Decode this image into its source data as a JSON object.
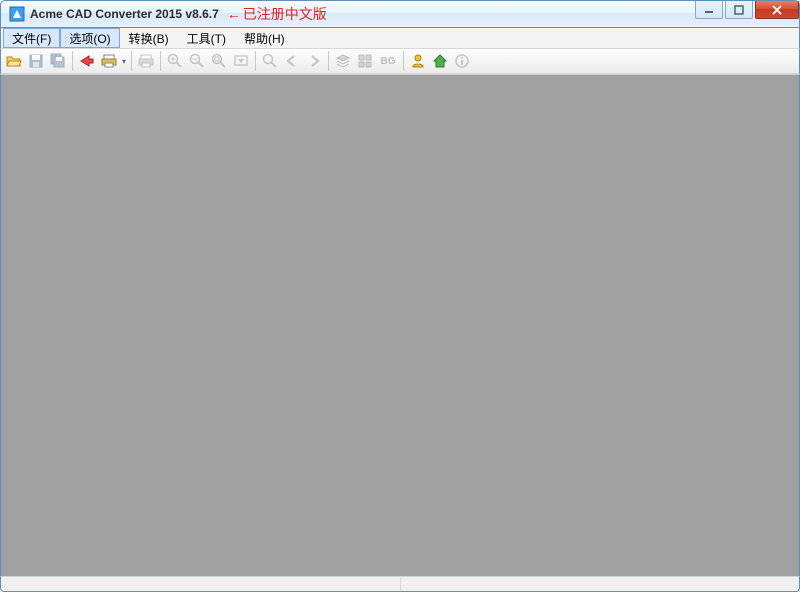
{
  "window": {
    "title": "Acme CAD Converter 2015 v8.6.7",
    "annotation": "已注册中文版",
    "annotation_arrow": "←"
  },
  "menu": {
    "file": "文件(F)",
    "options": "选项(O)",
    "convert": "转换(B)",
    "tools": "工具(T)",
    "help": "帮助(H)"
  },
  "toolbar": {
    "bg_label": "BG"
  },
  "icons": {
    "open": "open-folder-icon",
    "save": "save-icon",
    "save_all": "save-all-icon",
    "convert": "convert-icon",
    "print": "print-icon",
    "print2": "print-icon",
    "zoom_in": "zoom-in-icon",
    "zoom_out": "zoom-out-icon",
    "zoom_fit": "zoom-fit-icon",
    "zoom_window": "zoom-window-icon",
    "pan": "pan-icon",
    "prev": "prev-icon",
    "next": "next-icon",
    "layers": "layers-icon",
    "layouts": "layouts-icon",
    "bg": "background-toggle",
    "person": "person-icon",
    "home": "home-icon",
    "info": "info-icon"
  }
}
